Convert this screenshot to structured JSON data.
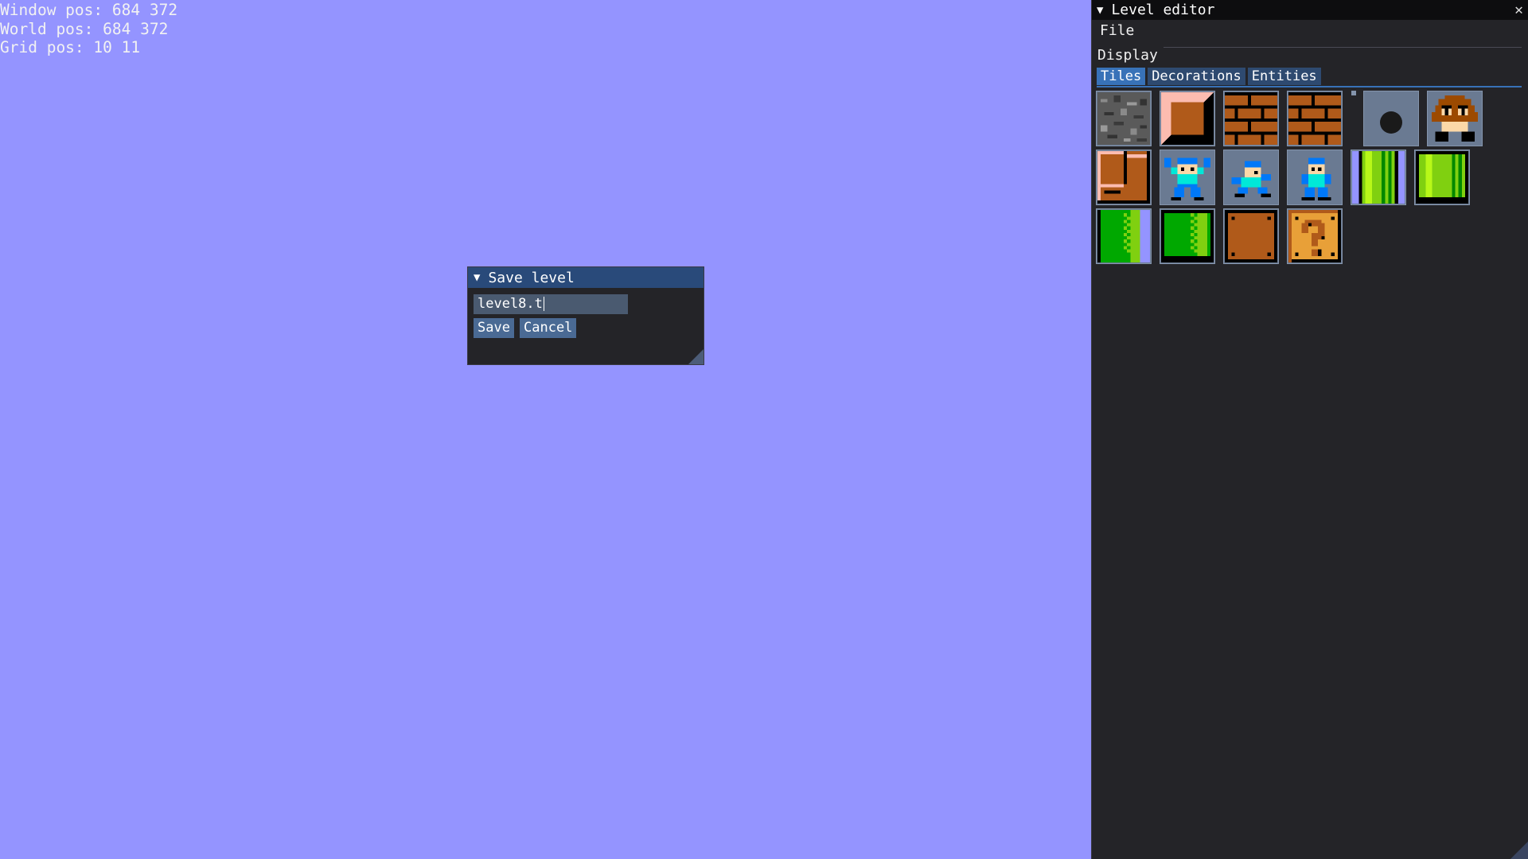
{
  "hud": {
    "window_pos": "Window pos: 684 372",
    "world_pos": "World pos: 684 372",
    "grid_pos": "Grid pos: 10 11"
  },
  "save_dialog": {
    "title": "Save level",
    "filename_value": "level8.t",
    "save_label": "Save",
    "cancel_label": "Cancel"
  },
  "editor": {
    "title": "Level editor",
    "close_glyph": "✕",
    "menu_file": "File",
    "display_label": "Display",
    "tabs": [
      {
        "label": "Tiles",
        "active": true
      },
      {
        "label": "Decorations",
        "active": false
      },
      {
        "label": "Entities",
        "active": false
      }
    ],
    "tiles": [
      "rock-tile-icon",
      "hard-block-tile-icon",
      "brick-tile-icon",
      "brick-tile-icon",
      "empty-tile-icon",
      "goomba-icon",
      "stair-block-tile-icon",
      "megaman-jump-icon",
      "megaman-run-icon",
      "megaman-stand-icon",
      "pipe-body-vertical-icon",
      "pipe-top-vertical-icon",
      "pipe-body-horizontal-icon",
      "pipe-top-horizontal-icon",
      "used-block-icon",
      "question-block-icon"
    ]
  },
  "colors": {
    "background": "#9494ff",
    "title_active": "#294a7a",
    "tab_active": "#3872b8",
    "panel": "#242428"
  }
}
